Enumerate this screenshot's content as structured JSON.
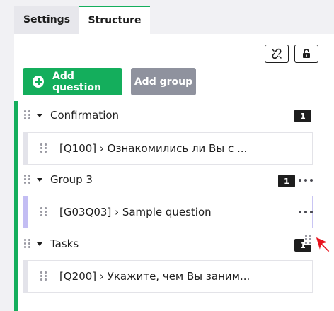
{
  "tabs": [
    {
      "label": "Settings",
      "active": false
    },
    {
      "label": "Structure",
      "active": true
    }
  ],
  "toolbar": {
    "unlink_icon": "unlink-icon",
    "lock_icon": "unlock-icon"
  },
  "buttons": {
    "add_question": "Add question",
    "add_group": "Add group"
  },
  "groups": [
    {
      "title": "Confirmation",
      "count": "1",
      "question": "[Q100] › Ознакомились ли Вы с ..."
    },
    {
      "title": "Group 3",
      "count": "1",
      "question": "[G03Q03] › Sample question"
    },
    {
      "title": "Tasks",
      "count": "1",
      "question": "[Q200] › Укажите, чем Вы заним..."
    }
  ],
  "colors": {
    "accent": "#14ae5c",
    "disabled_button": "#8f929e",
    "badge": "#1e1e1e",
    "highlight_border": "#c3bdf3",
    "cursor": "#e8141e"
  }
}
